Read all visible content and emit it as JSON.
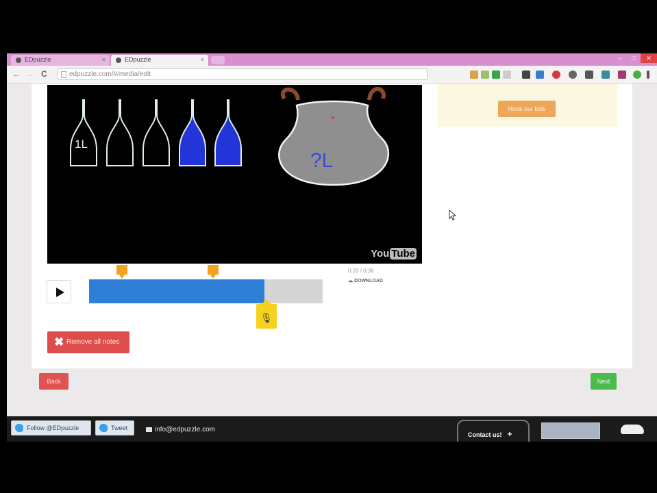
{
  "browser": {
    "tabs": [
      {
        "title": "EDpuzzle",
        "active": false
      },
      {
        "title": "EDpuzzle",
        "active": true
      }
    ],
    "address": "edpuzzle.com/#/media/edit",
    "window_controls": [
      "–",
      "□",
      "✕"
    ],
    "nav": {
      "back": "←",
      "forward": "→",
      "reload": "C"
    }
  },
  "video": {
    "watermark_text": "You",
    "watermark_badge": "Tube",
    "drawing": {
      "bottle_label": "1L",
      "pot_label": "?L"
    }
  },
  "side_panel": {
    "button_label": "Hook our kids"
  },
  "player": {
    "time": "0:20 / 0:36",
    "download_label": "DOWNLOAD",
    "progress_fraction": 0.75,
    "marker_fractions": [
      0.14,
      0.53
    ]
  },
  "actions": {
    "remove_label": "Remove all notes",
    "back_label": "Back",
    "next_label": "Next"
  },
  "footer": {
    "follow_label": "Follow @EDpuzzle",
    "tweet_label": "Tweet",
    "email": "info@edpuzzle.com",
    "contact_label": "Contact us!",
    "contact_plus": "+"
  },
  "colors": {
    "progress_fill": "#2f7fd8",
    "marker": "#f5a021",
    "mic_marker": "#f6d21f",
    "remove": "#df4c4c",
    "next": "#4cbb4c",
    "tab_strip": "#d98fcd"
  }
}
